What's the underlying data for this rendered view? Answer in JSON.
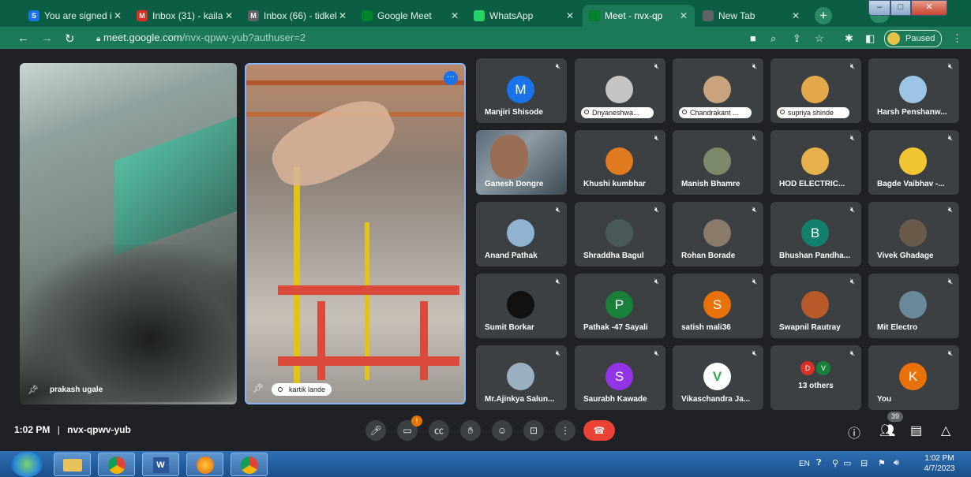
{
  "browser": {
    "tabs": [
      {
        "title": "You are signed in a",
        "favicon_color": "#1a73e8",
        "favicon_glyph": "S"
      },
      {
        "title": "Inbox (31) - kailas",
        "favicon_color": "#d93025",
        "favicon_glyph": "M"
      },
      {
        "title": "Inbox (66) - tidkek",
        "favicon_color": "#5f6368",
        "favicon_glyph": "M"
      },
      {
        "title": "Google Meet",
        "favicon_color": "#00832d",
        "favicon_glyph": ""
      },
      {
        "title": "WhatsApp",
        "favicon_color": "#25d366",
        "favicon_glyph": ""
      },
      {
        "title": "Meet - nvx-qp",
        "favicon_color": "#00832d",
        "favicon_glyph": "",
        "active": true
      },
      {
        "title": "New Tab",
        "favicon_color": "#5f6368",
        "favicon_glyph": ""
      }
    ],
    "url_host": "meet.google.com",
    "url_path": "/nvx-qpwv-yub?authuser=2",
    "profile_status": "Paused"
  },
  "meet": {
    "time": "1:02 PM",
    "separator": "|",
    "meeting_code": "nvx-qpwv-yub",
    "participant_count": "39",
    "pinned": [
      {
        "name": "prakash ugale"
      },
      {
        "name": "kartik lande"
      }
    ],
    "grid": [
      {
        "name": "Manjiri Shisode",
        "initial": "M",
        "color": "#1a73e8"
      },
      {
        "name": "Dnyaneshwa...",
        "initial": "",
        "color": "#c4c4c4",
        "pill": true
      },
      {
        "name": "Chandrakant ...",
        "initial": "",
        "color": "#c9a27e",
        "pill": true
      },
      {
        "name": "supriya shinde",
        "initial": "",
        "color": "#e2a84a",
        "pill": true
      },
      {
        "name": "Harsh Penshanw...",
        "initial": "",
        "color": "#9cc4e4"
      },
      {
        "name": "Ganesh Dongre",
        "initial": "",
        "color": "#6a7f8c",
        "video": true
      },
      {
        "name": "Khushi kumbhar",
        "initial": "",
        "color": "#e07a1e"
      },
      {
        "name": "Manish Bhamre",
        "initial": "",
        "color": "#7c8a6a"
      },
      {
        "name": "HOD ELECTRIC...",
        "initial": "",
        "color": "#e8b04a"
      },
      {
        "name": "Bagde Vaibhav -...",
        "initial": "",
        "color": "#f2c633"
      },
      {
        "name": "Anand Pathak",
        "initial": "",
        "color": "#8fb3d1"
      },
      {
        "name": "Shraddha Bagul",
        "initial": "",
        "color": "#4a5a5a"
      },
      {
        "name": "Rohan Borade",
        "initial": "",
        "color": "#8a7a6a"
      },
      {
        "name": "Bhushan Pandha...",
        "initial": "B",
        "color": "#12806c"
      },
      {
        "name": "Vivek Ghadage",
        "initial": "",
        "color": "#6a5a4a"
      },
      {
        "name": "Sumit Borkar",
        "initial": "",
        "color": "#111111"
      },
      {
        "name": "Pathak -47 Sayali",
        "initial": "P",
        "color": "#188038"
      },
      {
        "name": "satish mali36",
        "initial": "S",
        "color": "#e8710a"
      },
      {
        "name": "Swapnil Rautray",
        "initial": "",
        "color": "#b85a2a"
      },
      {
        "name": "Mit Electro",
        "initial": "",
        "color": "#6a8a9a"
      },
      {
        "name": "Mr.Ajinkya Salun...",
        "initial": "",
        "color": "#9ab0c0"
      },
      {
        "name": "Saurabh Kawade",
        "initial": "S",
        "color": "#9334e6"
      },
      {
        "name": "Vikaschandra Ja...",
        "initial": "V",
        "color": "#ffffff"
      },
      {
        "name": "13 others",
        "initial": "",
        "color": "",
        "others": true
      },
      {
        "name": "You",
        "initial": "K",
        "color": "#e8710a"
      }
    ],
    "others_initials": [
      "D",
      "V"
    ],
    "controls": [
      "mic",
      "camera",
      "captions",
      "raise-hand",
      "emoji",
      "present",
      "more",
      "leave"
    ],
    "camera_badge": "!"
  },
  "taskbar": {
    "lang": "EN",
    "time": "1:02 PM",
    "date": "4/7/2023"
  }
}
